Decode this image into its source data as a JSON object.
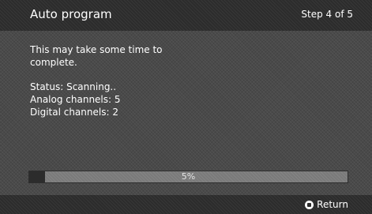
{
  "header": {
    "title": "Auto program",
    "step": "Step 4 of 5"
  },
  "content": {
    "message_line1": "This may take some time to",
    "message_line2": "complete.",
    "status": "Status: Scanning..",
    "analog": "Analog channels: 5",
    "digital": "Digital channels: 2"
  },
  "progress": {
    "percent": 5,
    "label": "5%"
  },
  "footer": {
    "return_label": "Return",
    "return_icon": "return-button-icon"
  }
}
